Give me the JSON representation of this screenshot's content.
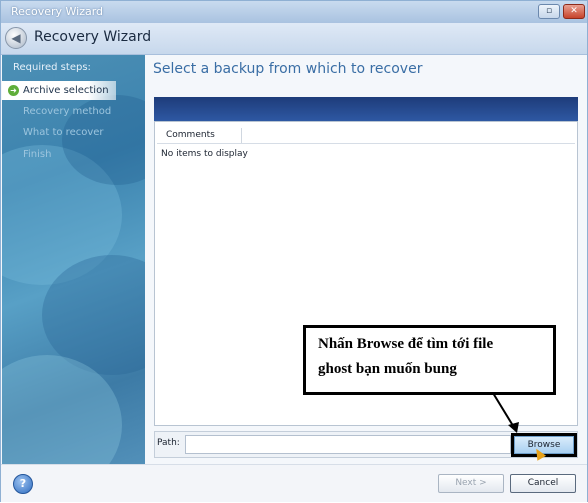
{
  "window": {
    "title": "Recovery Wizard",
    "controls": [
      "restore-icon",
      "close-icon"
    ]
  },
  "header": {
    "title": "Recovery Wizard",
    "back_icon": "back-arrow-icon"
  },
  "sidebar": {
    "heading": "Required steps:",
    "steps": [
      {
        "label": "Archive selection",
        "state": "active",
        "icon": "green-arrow-icon"
      },
      {
        "label": "Recovery method",
        "state": "pending"
      },
      {
        "label": "What to recover",
        "state": "pending"
      },
      {
        "label": "Finish",
        "state": "pending"
      }
    ]
  },
  "main": {
    "title": "Select a backup from which to recover",
    "list": {
      "columns": [
        "Comments"
      ],
      "empty_text": "No items to display"
    },
    "path": {
      "label": "Path:",
      "value": "",
      "browse_label": "Browse"
    }
  },
  "footer": {
    "help_icon": "help-icon",
    "next_label": "Next >",
    "cancel_label": "Cancel"
  },
  "callout": {
    "line1": "Nhấn Browse để tìm tới file",
    "line2": "ghost bạn muốn bung"
  },
  "colors": {
    "accent_title": "#3a6ea5",
    "sidebar_blue": "#3b82ae",
    "list_header_bar": "#1e3c7a",
    "callout_border": "#000000"
  }
}
